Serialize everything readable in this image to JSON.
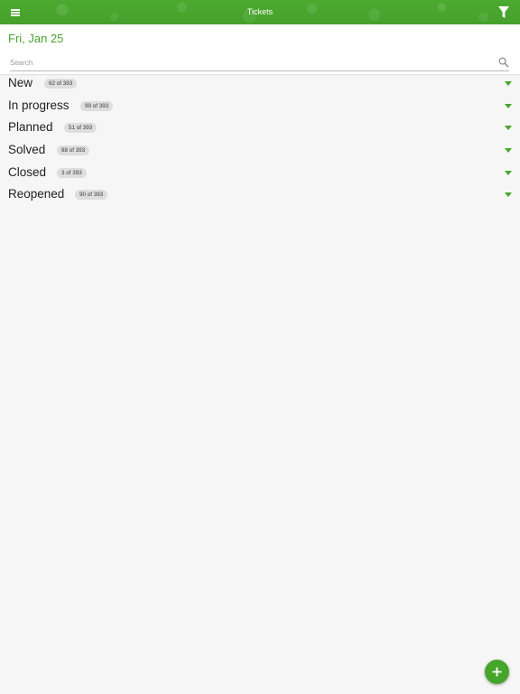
{
  "topbar": {
    "title": "Tickets",
    "menu_icon": "hamburger-menu-icon",
    "filter_icon": "filter-funnel-icon",
    "color": "#4aa52e"
  },
  "date_header": {
    "date": "Fri, Jan 25"
  },
  "search": {
    "placeholder": "Search",
    "value": "",
    "icon": "search-icon"
  },
  "groups": [
    {
      "name": "New",
      "count": "62 of 393"
    },
    {
      "name": "In progress",
      "count": "99 of 393"
    },
    {
      "name": "Planned",
      "count": "51 of 393"
    },
    {
      "name": "Solved",
      "count": "88 of 393"
    },
    {
      "name": "Closed",
      "count": "3 of 393"
    },
    {
      "name": "Reopened",
      "count": "90 of 393"
    }
  ],
  "fab": {
    "icon": "plus-icon"
  }
}
